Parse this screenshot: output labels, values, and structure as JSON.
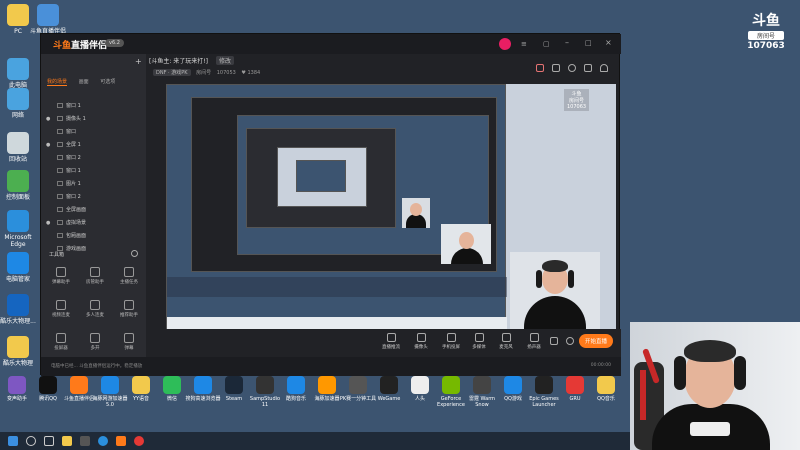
{
  "desktop": {
    "icons": [
      {
        "label": "PC",
        "color": "#f2c94c"
      },
      {
        "label": "斗鱼直播伴侣",
        "color": "#4a90d9"
      },
      {
        "label": "此电脑",
        "color": "#4aa3df"
      },
      {
        "label": "网络",
        "color": "#4aa3df"
      },
      {
        "label": "回收站",
        "color": "#cfd8dc"
      },
      {
        "label": "控制面板",
        "color": "#4caf50"
      },
      {
        "label": "Microsoft Edge",
        "color": "#2b8fdc"
      },
      {
        "label": "电脑管家",
        "color": "#1e88e5"
      },
      {
        "label": "酷乐大物理...",
        "color": "#1565c0"
      },
      {
        "label": "酷乐大物理",
        "color": "#f2c94c"
      }
    ],
    "taskbar_apps": [
      {
        "label": "变声助手",
        "color": "#7e57c2"
      },
      {
        "label": "腾讯QQ",
        "color": "#111111"
      },
      {
        "label": "斗鱼直播伴侣",
        "color": "#ff7a1a"
      },
      {
        "label": "海豚网游加速器5.0",
        "color": "#1e88e5"
      },
      {
        "label": "YY语音",
        "color": "#f2c94c"
      },
      {
        "label": "微信",
        "color": "#2ebd59"
      },
      {
        "label": "搜狗高速浏览器",
        "color": "#1e88e5"
      },
      {
        "label": "Steam",
        "color": "#1b2838"
      },
      {
        "label": "SampStudio 11",
        "color": "#333333"
      },
      {
        "label": "酷狗音乐",
        "color": "#1e88e5"
      },
      {
        "label": "海豚加速器",
        "color": "#ff9800"
      },
      {
        "label": "PK赛一分钟工具",
        "color": "#555555"
      },
      {
        "label": "WeGame",
        "color": "#222222"
      },
      {
        "label": "人头",
        "color": "#eeeeee"
      },
      {
        "label": "GeForce Experience",
        "color": "#76b900"
      },
      {
        "label": "雷霆 Warm Snow",
        "color": "#444444"
      },
      {
        "label": "QQ游戏",
        "color": "#1e88e5"
      },
      {
        "label": "Epic Games Launcher",
        "color": "#222222"
      },
      {
        "label": "GRU",
        "color": "#e53935"
      },
      {
        "label": "QQ音乐",
        "color": "#f2c94c"
      }
    ]
  },
  "app": {
    "logo": "直播伴侣",
    "logo_accent": "斗鱼",
    "version": "v6.2",
    "tabs": [
      "我的场景",
      "画面",
      "可选项"
    ],
    "scenes": [
      {
        "label": "窗口 1",
        "checked": false
      },
      {
        "label": "摄像头 1",
        "checked": true
      },
      {
        "label": "窗口",
        "checked": false
      },
      {
        "label": "全屏 1",
        "checked": true
      },
      {
        "label": "窗口 2",
        "checked": false
      },
      {
        "label": "窗口 1",
        "checked": false
      },
      {
        "label": "图片 1",
        "checked": false
      },
      {
        "label": "窗口 2",
        "checked": false
      },
      {
        "label": "全屏画面",
        "checked": false
      },
      {
        "label": "虚拟场景",
        "checked": true
      },
      {
        "label": "包厢画面",
        "checked": false
      },
      {
        "label": "游戏画面",
        "checked": false
      }
    ],
    "tools_title": "工具箱",
    "tools": [
      "弹幕助手",
      "房管助手",
      "主播任务",
      "视频连麦",
      "多人连麦",
      "推荐助手",
      "投屏器",
      "多开",
      "弹幕"
    ],
    "stream_title": "[斗鱼主: 来了玩来打!]",
    "stream_badge": "修改",
    "category": "DNF · 游戏PK",
    "room_label": "房间号",
    "room_id": "107053",
    "fans": "1384",
    "bottom_buttons": [
      "直播推流",
      "摄像头",
      "手机投屏",
      "多媒体",
      "麦克风",
      "扬声器"
    ],
    "start_button": "开始直播",
    "status_text": "电脑中已经... 斗鱼直播伴侣运行中。稳定播放",
    "stream_time": "00:00:00"
  },
  "overlay": {
    "platform": "斗鱼",
    "room_label": "房间号",
    "room_id": "107063"
  },
  "colors": {
    "accent": "#ff7a1a",
    "window_bg": "#212226",
    "desktop_bg": "#3c5470"
  }
}
